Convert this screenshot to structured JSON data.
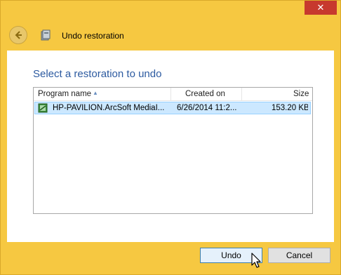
{
  "window": {
    "close_glyph": "✕"
  },
  "header": {
    "title": "Undo restoration",
    "back_icon": "back-arrow-icon",
    "app_icon": "restore-app-icon"
  },
  "main": {
    "instruction": "Select a restoration to undo",
    "list": {
      "columns": [
        {
          "label": "Program name",
          "sort": "ascending"
        },
        {
          "label": "Created on"
        },
        {
          "label": "Size"
        }
      ],
      "rows": [
        {
          "program": "HP-PAVILION.ArcSoft MediaI...",
          "created": "6/26/2014 11:2...",
          "size": "153.20 KB",
          "selected": true
        }
      ]
    }
  },
  "footer": {
    "undo_label": "Undo",
    "cancel_label": "Cancel"
  },
  "colors": {
    "frame": "#f6c841",
    "accent_text": "#2c5aa0",
    "selection": "#cce8ff",
    "close": "#c7392e"
  }
}
